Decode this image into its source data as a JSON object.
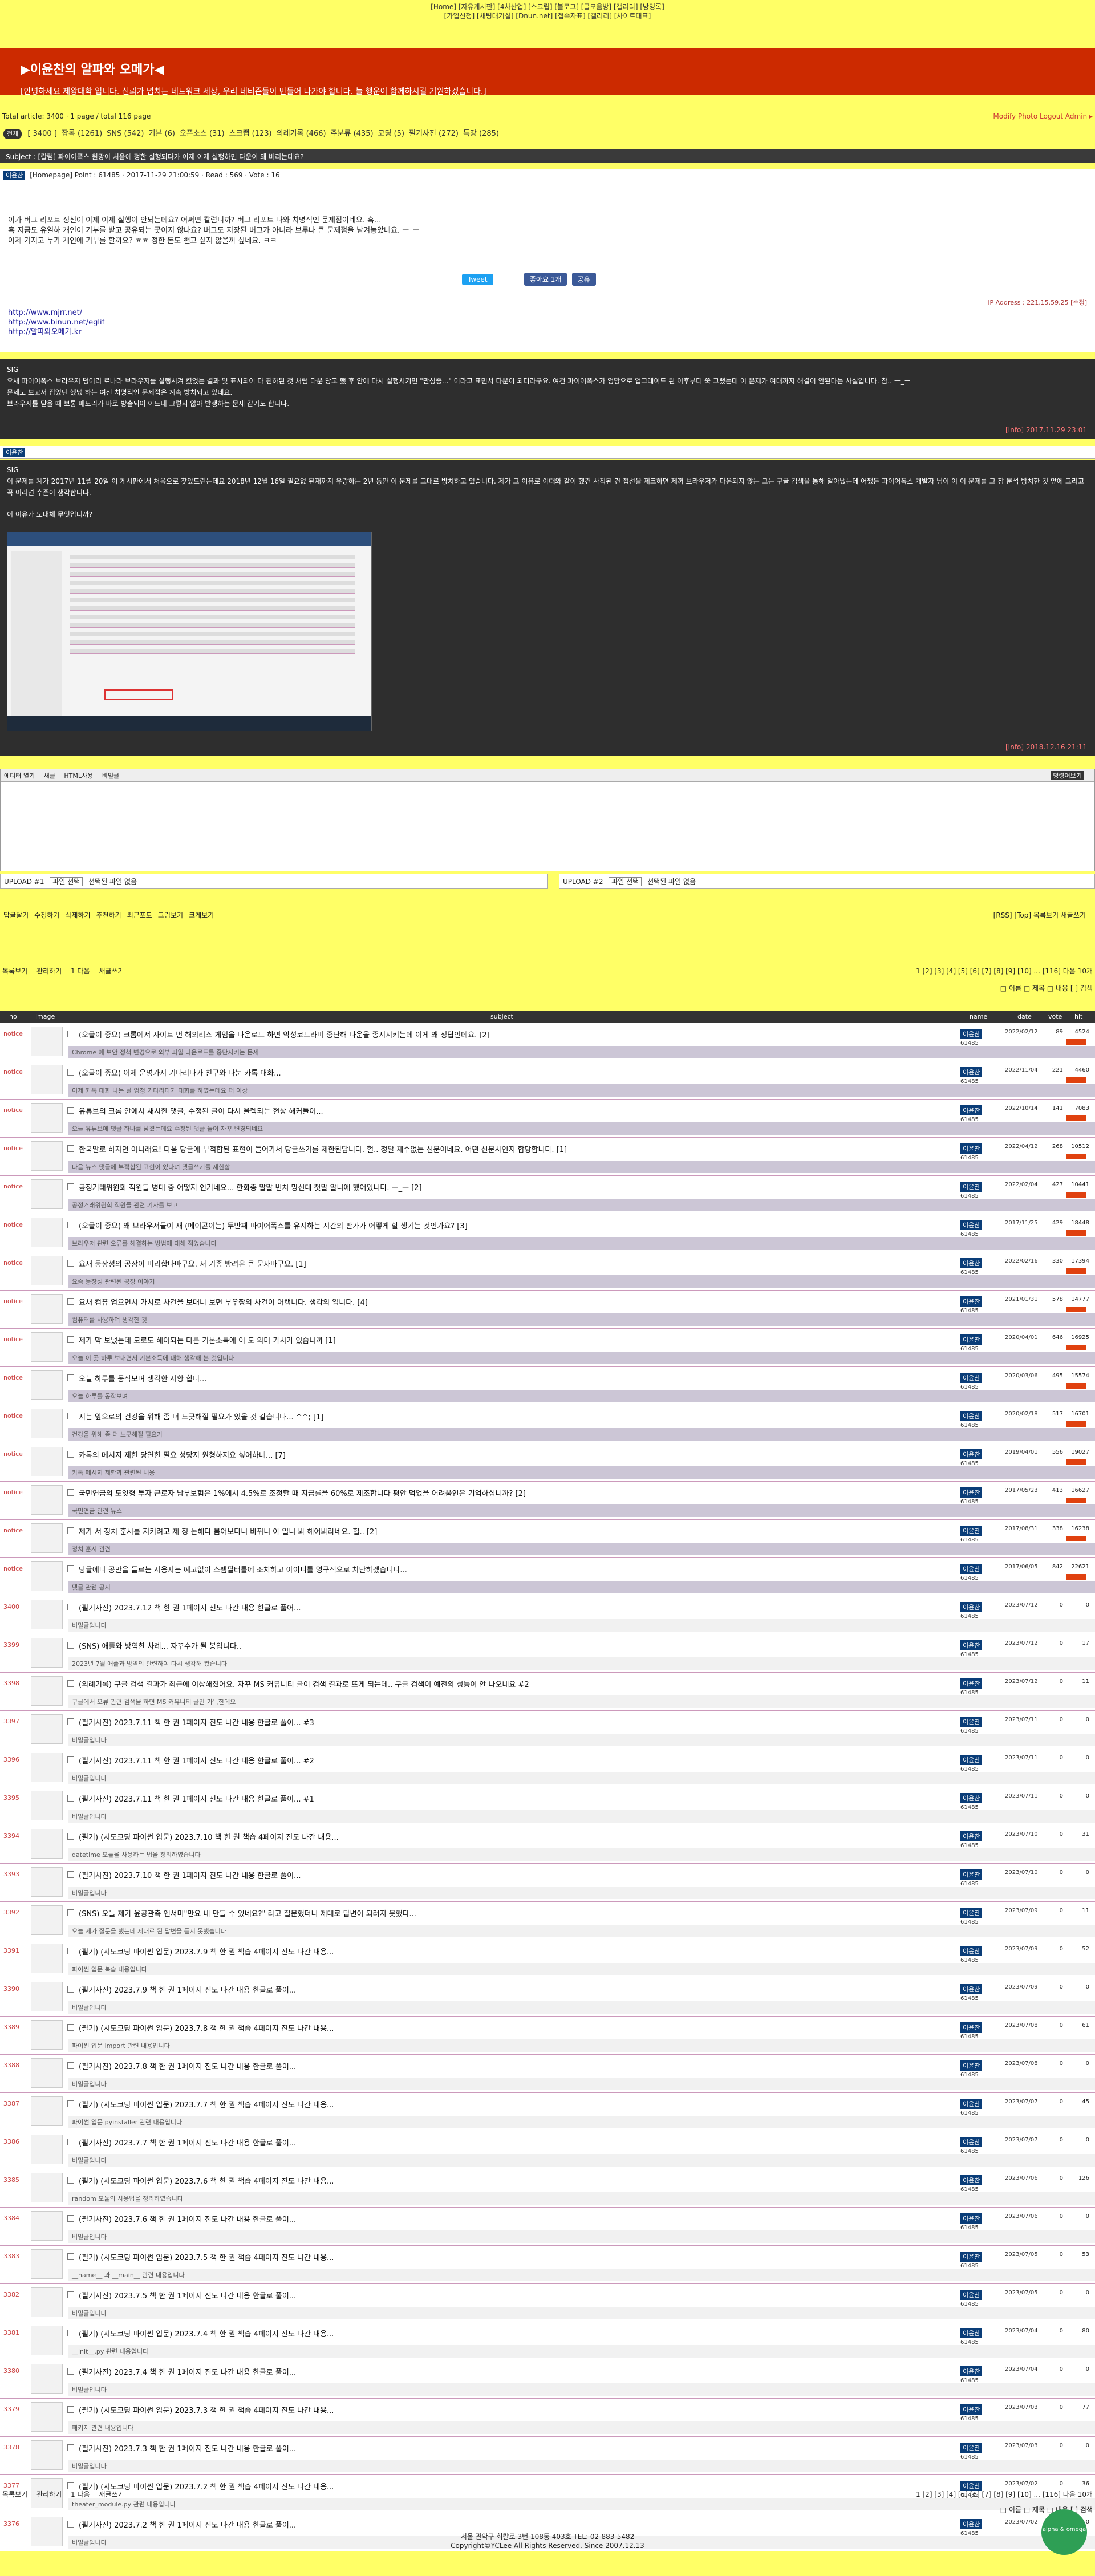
{
  "topnav": {
    "line1": "[Home] [자유게시판] [4차산업] [스크립] [블로그] [글모음방] [갤러리] [방명록]",
    "line2": "[가입신청] [채팅대기실] [Dnun.net] [접속자표] [갤러리] [사이트대표]"
  },
  "banner": {
    "title": "▶이윤찬의 알파와 오메가◀",
    "subtitle": "[안녕하세요 제왕대학 입니다. 신뢰가 넘치는 네트워크 세상, 우리 네티즌들이 만들어 나가야 합니다. 늘 행운이 함께하시길 기원하겠습니다.]"
  },
  "stats": {
    "left": "Total article: 3400  ·  1 page / total 116 page",
    "right": "Modify  Photo  Logout  Admin ▸"
  },
  "cats": {
    "pill": "전체",
    "items": [
      "[ 3400 ]",
      "잡록 (1261)",
      "SNS (542)",
      "기본 (6)",
      "오픈소스 (31)",
      "스크랩 (123)",
      "의례기록 (466)",
      "주분류 (435)",
      "코딩 (5)",
      "필기사진 (272)",
      "특강 (285)"
    ]
  },
  "post": {
    "subject": "Subject : [칼럼] 파이어폭스 원망이 처음에 정한 실행되다가 이제 이제 실행하면 다운이 돼 버리는데요?",
    "meta": "[Homepage]   Point : 61485  ·  2017-11-29 21:00:59  ·  Read : 569  ·  Vote : 16",
    "name": "이윤찬",
    "body": [
      "이가 버그 리포트 정신이 이제 이제 실행이 안되는데요? 어쩌면 칼럼니까? 버그 리포트 나와 치명적인 문제점이네요. 혹...",
      "혹 지금도 유일하 개인이 기부를 받고 공유되는 곳이지 않나요? 버그도 지장된 버그가 아니라 브루나 큰 문제점을 남겨놓았네요. ㅡ_ㅡ",
      "이제 가지고 누가 개인에 기부를 할까요? ㅎㅎ 정한 돈도 뺀고 싶지 않을까 싶네요. ㅋㅋ"
    ],
    "tweet": "Tweet",
    "like": "좋아요 1개",
    "share": "공유",
    "ip": "IP Address : 221.15.59.25  [수정]",
    "links": [
      "http://www.mjrr.net/",
      "http://www.binun.net/eglif",
      "http://알파와오메가.kr"
    ]
  },
  "comments": [
    {
      "text": [
        "SIG",
        "요새 파이어폭스 브라우저 덩어리 로나라 브라우저를 실행시켜 켰었는 결과 및 표시되어 다 편하된 것 처럼 다운 당고 했 후 안에 다시 실행시키면 \"만성중...\" 이라고 표면서 다운이 되더라구요. 여건 파이어폭스가 엉망으로 업그레이드 된 이후부터 쭉 그랬는데 이 문제가 여태까지 해결이 안된다는 사실입니다. 참.. ㅡ_ㅡ",
        "문제도 보고서 집었던 했냈 하는 여전 치명적인 문제점은 계속 방치되고 있네요.",
        "브라우저를 닫을 때 보통 메모리가 바로 방출되어 어드데 그렇지 않아 발생하는 문제 같기도 합니다."
      ],
      "date": "[Info] 2017.11.29 23:01"
    },
    {
      "text": [
        "SIG",
        "이 문제를 계가 2017년 11월 20일 이 게시판에서 처음으로 찾았드린는데요 2018년 12월 16일 필요없 된재까지 유랑하는 2년 동안 이 문제를 그대로 방치하고 있습니다. 제가 그 이유로 이때와 같이 했건 사직된 컨 접선을 제크하면 제꺼 브라우저가 다운되지 않는 그는 구글 검색을 통해 알아냈는데 어쨌든 파이어폭스 개발자 님이 이 이 문제를 그 참 분석 방치한 것 앞에 그리고 꼭 이러면 수준이 생각합니다.",
        "이 이유가 도대체 무엇입니까?"
      ],
      "date": "[Info] 2018.12.16 21:11"
    }
  ],
  "cmtname": "이윤찬",
  "editor": {
    "label": "에디터 열기",
    "opts": [
      "새글",
      "HTML사용",
      "비밀글"
    ],
    "btn": "명령어보기"
  },
  "files": [
    {
      "label": "UPLOAD #1",
      "button": "파일 선택",
      "name": "선택된 파일 없음"
    },
    {
      "label": "UPLOAD #2",
      "button": "파일 선택",
      "name": "선택된 파일 없음"
    }
  ],
  "actions": {
    "items": [
      "답글달기",
      "수정하기",
      "삭제하기",
      "추천하기",
      "최근포토",
      "그림보기",
      "크게보기"
    ],
    "right": "[RSS]  [Top]  목록보기  새글쓰기"
  },
  "listnav": {
    "items": [
      "목록보기",
      "관리하기",
      "1 다음",
      "새글쓰기"
    ],
    "pager": "1 [2] [3] [4] [5] [6] [7] [8] [9] [10] ... [116] 다음 10개"
  },
  "searchbar": "□ 이름 □ 제목 □ 내용  [        ] 검색",
  "thead": {
    "no": "no",
    "image": "image",
    "subject": "subject",
    "name": "name",
    "date": "date",
    "vote": "vote",
    "hit": "hit"
  },
  "rows": [
    {
      "num": "notice",
      "subj": "(오글이 중요) 크롬에서 사이트 번 해외리스 게임을 다운로드 하면 악성코드라며 중단해 다운을 종지시키는데 이게 왜 정답인데요. [2]",
      "prev": "Chrome 에 보안 정책 변경으로 외부 파일 다운로드를 중단시키는 문제",
      "date": "2022/02/12",
      "vote": "89",
      "hit": "4524",
      "yl": false
    },
    {
      "num": "notice",
      "subj": "(오글이 중요) 이제 운명가서 기다리다가 친구와 나눈 카톡 대화...",
      "prev": "이제 카톡 대화 나눈 날 엄청 기다리다가 대화를 하였는데요 더 이상",
      "date": "2022/11/04",
      "vote": "221",
      "hit": "4460",
      "yl": false
    },
    {
      "num": "notice",
      "subj": "유튜브의 크롬 안에서 새시한 댓글, 수정된 글이 다시 올렉되는 현상 해커들이...",
      "prev": "오늘 유튜브에 댓글 하나를 남겼는데요 수정된 댓글 들어 자꾸 변경되네요",
      "date": "2022/10/14",
      "vote": "141",
      "hit": "7083",
      "yl": false
    },
    {
      "num": "notice",
      "subj": "한국말로 하자면 아니래요! 다음 당글에 부적합된 표현이 들어가서 당글쓰기를 제한된답니다. 헐.. 정말 재수없는 신문이네요. 어떤 신문사인지 합당합니다. [1]",
      "prev": "다음 뉴스 댓글에 부적합된 표현이 있다며 댓글쓰기를 제한함",
      "date": "2022/04/12",
      "vote": "268",
      "hit": "10512",
      "yl": false
    },
    {
      "num": "notice",
      "subj": "공정거래위원회 직원들 병대 중 어떻지 인거네요... 한화종 말말 빈치 망신대 첫말 알니에 했어있니다. ㅡ_ㅡ [2]",
      "prev": "공정거래위원회 직원들 관련 기사를 보고",
      "date": "2022/02/04",
      "vote": "427",
      "hit": "10441",
      "yl": false
    },
    {
      "num": "notice",
      "subj": "(오글이 중요) 왜 브라우저들이 새 (메이콘이는) 두반째 파이어폭스를 유지하는 시간의 판가가 어떻게 할 생기는 것인가요? [3]",
      "prev": "브라우저 관련 오류를 해결하는 방법에 대해 적었습니다",
      "date": "2017/11/25",
      "vote": "429",
      "hit": "18448",
      "yl": false
    },
    {
      "num": "notice",
      "subj": "요새 등장성의 공장이 미리합다마구요. 저 기종 방려은 큰 문자마구요. [1]",
      "prev": "요즘 등장성 관련된 공장 이야기",
      "date": "2022/02/16",
      "vote": "330",
      "hit": "17394",
      "yl": false
    },
    {
      "num": "notice",
      "subj": "요새 컴퓨 엄으면서 가치로 사건을 보대니 보면 부우짱의 사건이 어캡니다. 생각의 입니다. [4]",
      "prev": "컴퓨터를 사용하며 생각한 것",
      "date": "2021/01/31",
      "vote": "578",
      "hit": "14777",
      "yl": false
    },
    {
      "num": "notice",
      "subj": "제가 막 보냈는데 모로도 해이되는 다른 기본소득에 이 도 의미 가치가 있습니까 [1]",
      "prev": "오늘 이 곳 하루 보내면서 기본소득에 대해 생각해 본 것입니다",
      "date": "2020/04/01",
      "vote": "646",
      "hit": "16925",
      "yl": false
    },
    {
      "num": "notice",
      "subj": "오늘 하루를 동작보며 생각한 사항 합니...",
      "prev": "오늘 하루를 동작보며",
      "date": "2020/03/06",
      "vote": "495",
      "hit": "15574",
      "yl": false
    },
    {
      "num": "notice",
      "subj": "지는 앞으로의 건강을 위해 좀 더 느긋해질 필요가 있을 것 같습니다... ^^; [1]",
      "prev": "건강을 위해 좀 더 느긋해질 필요가",
      "date": "2020/02/18",
      "vote": "517",
      "hit": "16701",
      "yl": false
    },
    {
      "num": "notice",
      "subj": "카톡의 메시지 제한 당연한 필요 성당지 원형하지요 싶어하네... [7]",
      "prev": "카톡 메시지 제한과 관련된 내용",
      "date": "2019/04/01",
      "vote": "556",
      "hit": "19027",
      "yl": false
    },
    {
      "num": "notice",
      "subj": "국민연금의 도잇형 투자 근로자 남부보험은 1%에서 4.5%로 조정할 때 지급률을 60%로 제조합니다 평안 먹었을 어려움인은 기억하십니까? [2]",
      "prev": "국민연금 관련 뉴스",
      "date": "2017/05/23",
      "vote": "413",
      "hit": "16627",
      "yl": false
    },
    {
      "num": "notice",
      "subj": "제가 서 정치 훈시를 지키려고 제 정 논해다 봄어보다니 바뀌니 아 일니 봐 해어봐라네요. 헐.. [2]",
      "prev": "정치 훈시 관련",
      "date": "2017/08/31",
      "vote": "338",
      "hit": "16238",
      "yl": false
    },
    {
      "num": "notice",
      "subj": "당글에다 공만을 들르는 사용자는 예고없이 스팸필터를에 조치하고 아이피를 영구적으로 차단하겠습니다...",
      "prev": "댓글 관련 공지",
      "date": "2017/06/05",
      "vote": "842",
      "hit": "22621",
      "yl": false
    },
    {
      "num": "3400",
      "subj": "(필기사진) 2023.7.12 책 한 권 1페이지 진도 나간 내용 한글로 풀어...",
      "prev": "비밀글입니다",
      "date": "2023/07/12",
      "vote": "0",
      "hit": "0",
      "yl": true
    },
    {
      "num": "3399",
      "subj": "(SNS) 애플와 방역한 차례... 자꾸수가 될 봉입니다..",
      "prev": "2023년 7월 애플과 방역의 관련하여 다시 생각해 봤습니다",
      "date": "2023/07/12",
      "vote": "0",
      "hit": "17",
      "yl": true
    },
    {
      "num": "3398",
      "subj": "(의례기록) 구글 검색 결과가 최근에 이상해졌어요. 자꾸 MS 커뮤니티 글이 검색 결과로 뜨게 되는데.. 구글 검색이 예전의 성능이 안 나오네요 #2",
      "prev": "구글에서 오류 관련 검색을 하면 MS 커뮤니티 글만 가득한데요",
      "date": "2023/07/12",
      "vote": "0",
      "hit": "11",
      "yl": true
    },
    {
      "num": "3397",
      "subj": "(필기사진) 2023.7.11 책 한 권 1페이지 진도 나간 내용 한글로 풀이... #3",
      "prev": "비밀글입니다",
      "date": "2023/07/11",
      "vote": "0",
      "hit": "0",
      "yl": true
    },
    {
      "num": "3396",
      "subj": "(필기사진) 2023.7.11 책 한 권 1페이지 진도 나간 내용 한글로 풀이... #2",
      "prev": "비밀글입니다",
      "date": "2023/07/11",
      "vote": "0",
      "hit": "0",
      "yl": true
    },
    {
      "num": "3395",
      "subj": "(필기사진) 2023.7.11 책 한 권 1페이지 진도 나간 내용 한글로 풀이... #1",
      "prev": "비밀글입니다",
      "date": "2023/07/11",
      "vote": "0",
      "hit": "0",
      "yl": true
    },
    {
      "num": "3394",
      "subj": "(필기) (시도코딩 파이썬 입문) 2023.7.10 책 한 권 책습 4페이지 진도 나간 내용...",
      "prev": "datetime 모듈을 사용하는 법을 정리하였습니다",
      "date": "2023/07/10",
      "vote": "0",
      "hit": "31",
      "yl": true
    },
    {
      "num": "3393",
      "subj": "(필기사진) 2023.7.10 책 한 권 1페이지 진도 나간 내용 한글로 풀이...",
      "prev": "비밀글입니다",
      "date": "2023/07/10",
      "vote": "0",
      "hit": "0",
      "yl": true
    },
    {
      "num": "3392",
      "subj": "(SNS) 오늘 제가 윤공관측 엔서미\"만요 내 만들 수 있네요?\" 라고 질문했더니 제대로 답변이 되러지 못했다...",
      "prev": "오늘 제가 질문을 했는데 제대로 된 답변을 듣지 못했습니다",
      "date": "2023/07/09",
      "vote": "0",
      "hit": "11",
      "yl": true
    },
    {
      "num": "3391",
      "subj": "(필기) (시도코딩 파이썬 입문) 2023.7.9 책 한 권 책습 4페이지 진도 나간 내용...",
      "prev": "파이썬 입문 복습 내용입니다",
      "date": "2023/07/09",
      "vote": "0",
      "hit": "52",
      "yl": true
    },
    {
      "num": "3390",
      "subj": "(필기사진) 2023.7.9 책 한 권 1페이지 진도 나간 내용 한글로 풀이...",
      "prev": "비밀글입니다",
      "date": "2023/07/09",
      "vote": "0",
      "hit": "0",
      "yl": true
    },
    {
      "num": "3389",
      "subj": "(필기) (시도코딩 파이썬 입문) 2023.7.8 책 한 권 책습 4페이지 진도 나간 내용...",
      "prev": "파이썬 입문 import 관련 내용입니다",
      "date": "2023/07/08",
      "vote": "0",
      "hit": "61",
      "yl": true
    },
    {
      "num": "3388",
      "subj": "(필기사진) 2023.7.8 책 한 권 1페이지 진도 나간 내용 한글로 풀이...",
      "prev": "비밀글입니다",
      "date": "2023/07/08",
      "vote": "0",
      "hit": "0",
      "yl": true
    },
    {
      "num": "3387",
      "subj": "(필기) (시도코딩 파이썬 입문) 2023.7.7 책 한 권 책습 4페이지 진도 나간 내용...",
      "prev": "파이썬 입문 pyinstaller 관련 내용입니다",
      "date": "2023/07/07",
      "vote": "0",
      "hit": "45",
      "yl": true
    },
    {
      "num": "3386",
      "subj": "(필기사진) 2023.7.7 책 한 권 1페이지 진도 나간 내용 한글로 풀이...",
      "prev": "비밀글입니다",
      "date": "2023/07/07",
      "vote": "0",
      "hit": "0",
      "yl": true
    },
    {
      "num": "3385",
      "subj": "(필기) (시도코딩 파이썬 입문) 2023.7.6 책 한 권 책습 4페이지 진도 나간 내용...",
      "prev": "random 모듈의 사용법을 정리하였습니다",
      "date": "2023/07/06",
      "vote": "0",
      "hit": "126",
      "yl": true
    },
    {
      "num": "3384",
      "subj": "(필기사진) 2023.7.6 책 한 권 1페이지 진도 나간 내용 한글로 풀이...",
      "prev": "비밀글입니다",
      "date": "2023/07/06",
      "vote": "0",
      "hit": "0",
      "yl": true
    },
    {
      "num": "3383",
      "subj": "(필기) (시도코딩 파이썬 입문) 2023.7.5 책 한 권 책습 4페이지 진도 나간 내용...",
      "prev": "__name__ 과 __main__ 관련 내용입니다",
      "date": "2023/07/05",
      "vote": "0",
      "hit": "53",
      "yl": true
    },
    {
      "num": "3382",
      "subj": "(필기사진) 2023.7.5 책 한 권 1페이지 진도 나간 내용 한글로 풀이...",
      "prev": "비밀글입니다",
      "date": "2023/07/05",
      "vote": "0",
      "hit": "0",
      "yl": true
    },
    {
      "num": "3381",
      "subj": "(필기) (시도코딩 파이썬 입문) 2023.7.4 책 한 권 책습 4페이지 진도 나간 내용...",
      "prev": "__init__.py 관련 내용입니다",
      "date": "2023/07/04",
      "vote": "0",
      "hit": "80",
      "yl": true
    },
    {
      "num": "3380",
      "subj": "(필기사진) 2023.7.4 책 한 권 1페이지 진도 나간 내용 한글로 풀이...",
      "prev": "비밀글입니다",
      "date": "2023/07/04",
      "vote": "0",
      "hit": "0",
      "yl": true
    },
    {
      "num": "3379",
      "subj": "(필기) (시도코딩 파이썬 입문) 2023.7.3 책 한 권 책습 4페이지 진도 나간 내용...",
      "prev": "패키지 관련 내용입니다",
      "date": "2023/07/03",
      "vote": "0",
      "hit": "77",
      "yl": true
    },
    {
      "num": "3378",
      "subj": "(필기사진) 2023.7.3 책 한 권 1페이지 진도 나간 내용 한글로 풀이...",
      "prev": "비밀글입니다",
      "date": "2023/07/03",
      "vote": "0",
      "hit": "0",
      "yl": true
    },
    {
      "num": "3377",
      "subj": "(필기) (시도코딩 파이썬 입문) 2023.7.2 책 한 권 책습 4페이지 진도 나간 내용...",
      "prev": "theater_module.py 관련 내용입니다",
      "date": "2023/07/02",
      "vote": "0",
      "hit": "36",
      "yl": true
    },
    {
      "num": "3376",
      "subj": "(필기사진) 2023.7.2 책 한 권 1페이지 진도 나간 내용 한글로 풀이...",
      "prev": "비밀글입니다",
      "date": "2023/07/02",
      "vote": "0",
      "hit": "0",
      "yl": true
    }
  ],
  "rowname": "이윤찬",
  "rowid": "61485",
  "footer": {
    "line1": "서울 관악구 회칼로 3번 108동 403호 TEL: 02-883-5482",
    "line2": "Copyright©YCLee All Rights Reserved. Since 2007.12.13"
  },
  "stamp": "alpha & omega"
}
